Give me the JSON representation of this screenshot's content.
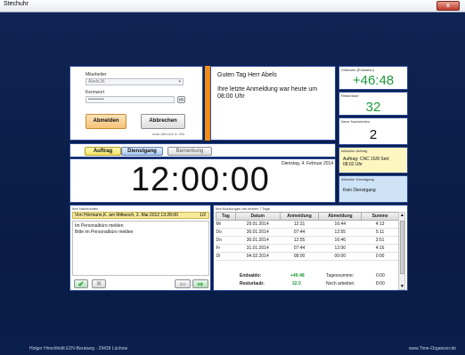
{
  "window": {
    "title": "Stechuhr",
    "close": "x"
  },
  "login": {
    "employee_label": "Mitarbeiter",
    "employee_value": "Abels,M.",
    "password_label": "Kennwort",
    "password_value": "••••••••",
    "logout_button": "Abmelden",
    "cancel_button": "Abbrechen",
    "auto_logout": "Auto.Abbruch in 29s"
  },
  "greeting": {
    "line1": "Guten Tag Herr Abels",
    "line2": "Ihre letzte Anmeldung war heute um 08:00 Uhr"
  },
  "stats": {
    "zeitkonto_label": "Zeitkonto (Endsaldo)",
    "zeitkonto_value": "+46:48",
    "resturlaub_label": "Resturlaub",
    "resturlaub_value": "32",
    "nachrichten_label": "Neue Nachrichten",
    "nachrichten_value": "2",
    "auftrag_label": "Aktueller Auftrag",
    "auftrag_value": "Auftrag: CNC 16/8 Seit: 08:02 Uhr",
    "dienstgang_label": "Aktueller Dienstgang",
    "dienstgang_value": "Kein Dienstgang"
  },
  "modes": {
    "auftrag": "Auftrag",
    "dienstgang": "Dienstgang",
    "bemerkung": "Bemerkung"
  },
  "clock": {
    "time": "12:00:00",
    "date": "Dienstag, 4. Februar 2014"
  },
  "messages": {
    "label": "Ihre Nachrichten",
    "header": "Von Hörmann,K. am Mittwoch, 2. Mai 2012 13:28:00",
    "counter": "1/2",
    "line1": "Im Personalbüro melden",
    "line2": "Bitte im Personalbüro melden"
  },
  "bookings": {
    "label": "Ihre Buchungen der letzten 7 Tage",
    "columns": [
      "Tag",
      "Datum",
      "Anmeldung",
      "Abmeldung",
      "Summe"
    ],
    "rows": [
      [
        "Mi",
        "29.01.2014",
        "12:31",
        "16:44",
        "4:13"
      ],
      [
        "Do",
        "30.01.2014",
        "07:44",
        "12:55",
        "5:11"
      ],
      [
        "Do",
        "30.01.2014",
        "12:55",
        "16:46",
        "3:51"
      ],
      [
        "Fr",
        "31.01.2014",
        "07:44",
        "12:00",
        "4:16"
      ],
      [
        "Di",
        "04.02.2014",
        "08:00",
        "00:00",
        "0:00"
      ]
    ],
    "endsaldo_label": "Endsaldo:",
    "endsaldo_value": "+46:48",
    "tagessumme_label": "Tagessumme:",
    "tagessumme_value": "0:00",
    "resturlaub_label": "Resturlaub:",
    "resturlaub_value": "32.0",
    "noch_label": "Noch arbeiten:",
    "noch_value": "8:00"
  },
  "footer": {
    "left": "Holger Hirschfeldt EDV-Beratung - 29439 Lüchow",
    "right": "www.Time-Organizer.de"
  },
  "colors": {
    "accent_green": "#1e9a3a",
    "orange_bar": "#f08c1a",
    "highlight": "#fdf6c0"
  }
}
